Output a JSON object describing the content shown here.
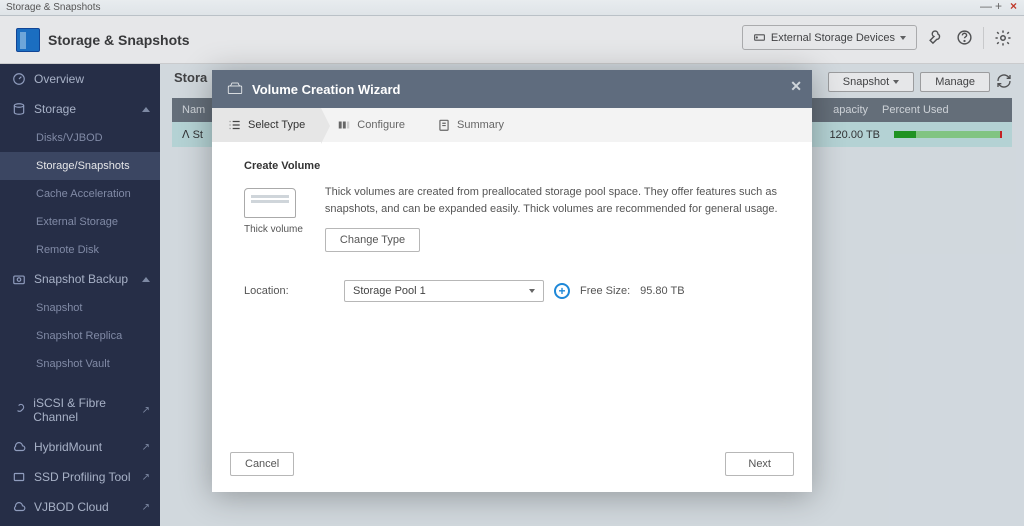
{
  "window_title": "Storage & Snapshots",
  "app_title": "Storage & Snapshots",
  "header": {
    "external_devices": "External Storage Devices"
  },
  "sidebar": {
    "overview": "Overview",
    "storage": "Storage",
    "storage_children": {
      "disks": "Disks/VJBOD",
      "storage_snapshots": "Storage/Snapshots",
      "cache_accel": "Cache Acceleration",
      "external_storage": "External Storage",
      "remote_disk": "Remote Disk"
    },
    "snapshot_backup": "Snapshot Backup",
    "snapshot_children": {
      "snapshot": "Snapshot",
      "replica": "Snapshot Replica",
      "vault": "Snapshot Vault"
    },
    "iscsi": "iSCSI & Fibre Channel",
    "hybrid": "HybridMount",
    "ssd_profile": "SSD Profiling Tool",
    "vjbod_cloud": "VJBOD Cloud"
  },
  "content": {
    "heading": "Stora",
    "snapshot_btn": "Snapshot",
    "manage_btn": "Manage",
    "col_name": "Nam",
    "col_capacity": "apacity",
    "col_percent": "Percent Used",
    "row_name": "St",
    "row_capacity": "120.00 TB"
  },
  "modal": {
    "title": "Volume Creation Wizard",
    "steps": {
      "select_type": "Select Type",
      "configure": "Configure",
      "summary": "Summary"
    },
    "section_title": "Create Volume",
    "description": "Thick volumes are created from preallocated storage pool space. They offer features such as snapshots, and can be expanded easily. Thick volumes are recommended for general usage.",
    "thick_label": "Thick volume",
    "change_type": "Change Type",
    "location_label": "Location:",
    "location_value": "Storage Pool 1",
    "free_size_label": "Free Size:",
    "free_size_value": "95.80 TB",
    "cancel": "Cancel",
    "next": "Next"
  }
}
